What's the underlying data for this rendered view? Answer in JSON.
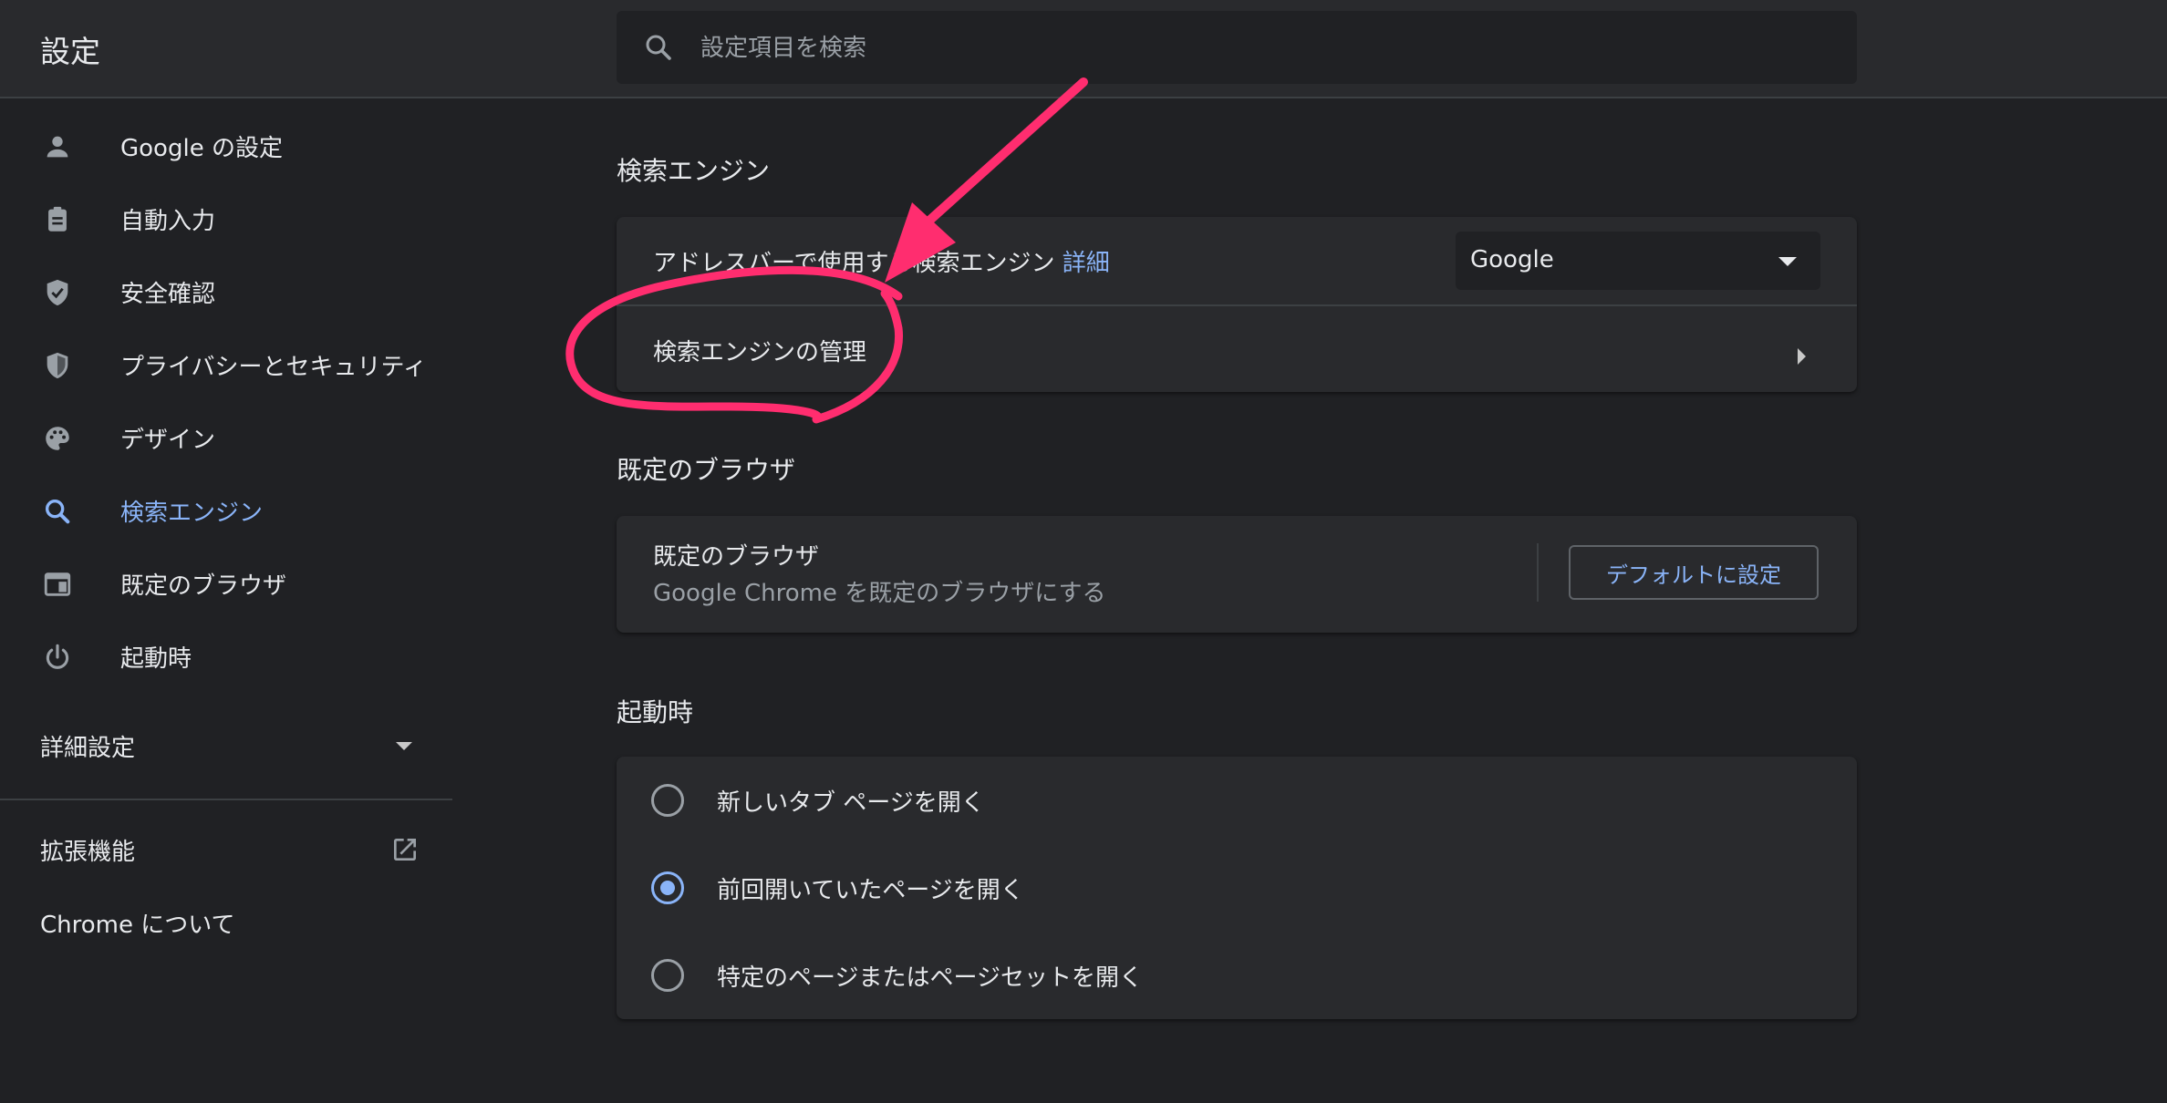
{
  "header": {
    "title": "設定",
    "search_placeholder": "設定項目を検索"
  },
  "sidebar": {
    "items": [
      {
        "label": "Google の設定",
        "icon": "person-icon"
      },
      {
        "label": "自動入力",
        "icon": "clipboard-icon"
      },
      {
        "label": "安全確認",
        "icon": "shield-check-icon"
      },
      {
        "label": "プライバシーとセキュリティ",
        "icon": "shield-icon"
      },
      {
        "label": "デザイン",
        "icon": "palette-icon"
      },
      {
        "label": "検索エンジン",
        "icon": "search-icon",
        "active": true
      },
      {
        "label": "既定のブラウザ",
        "icon": "browser-icon"
      },
      {
        "label": "起動時",
        "icon": "power-icon"
      }
    ],
    "advanced_label": "詳細設定",
    "extensions_label": "拡張機能",
    "about_label": "Chrome について"
  },
  "search_engine": {
    "title": "検索エンジン",
    "address_bar_text": "アドレスバーで使用する検索エンジン",
    "details_link": "詳細",
    "selected_engine": "Google",
    "manage_label": "検索エンジンの管理"
  },
  "default_browser": {
    "title": "既定のブラウザ",
    "row_title": "既定のブラウザ",
    "row_subtitle": "Google Chrome を既定のブラウザにする",
    "button_label": "デフォルトに設定"
  },
  "startup": {
    "title": "起動時",
    "options": [
      {
        "label": "新しいタブ ページを開く",
        "checked": false
      },
      {
        "label": "前回開いていたページを開く",
        "checked": true
      },
      {
        "label": "特定のページまたはページセットを開く",
        "checked": false
      }
    ]
  },
  "colors": {
    "background": "#202124",
    "surface": "#292a2d",
    "accent": "#8ab4f8",
    "annotation": "#ff2d6f"
  }
}
